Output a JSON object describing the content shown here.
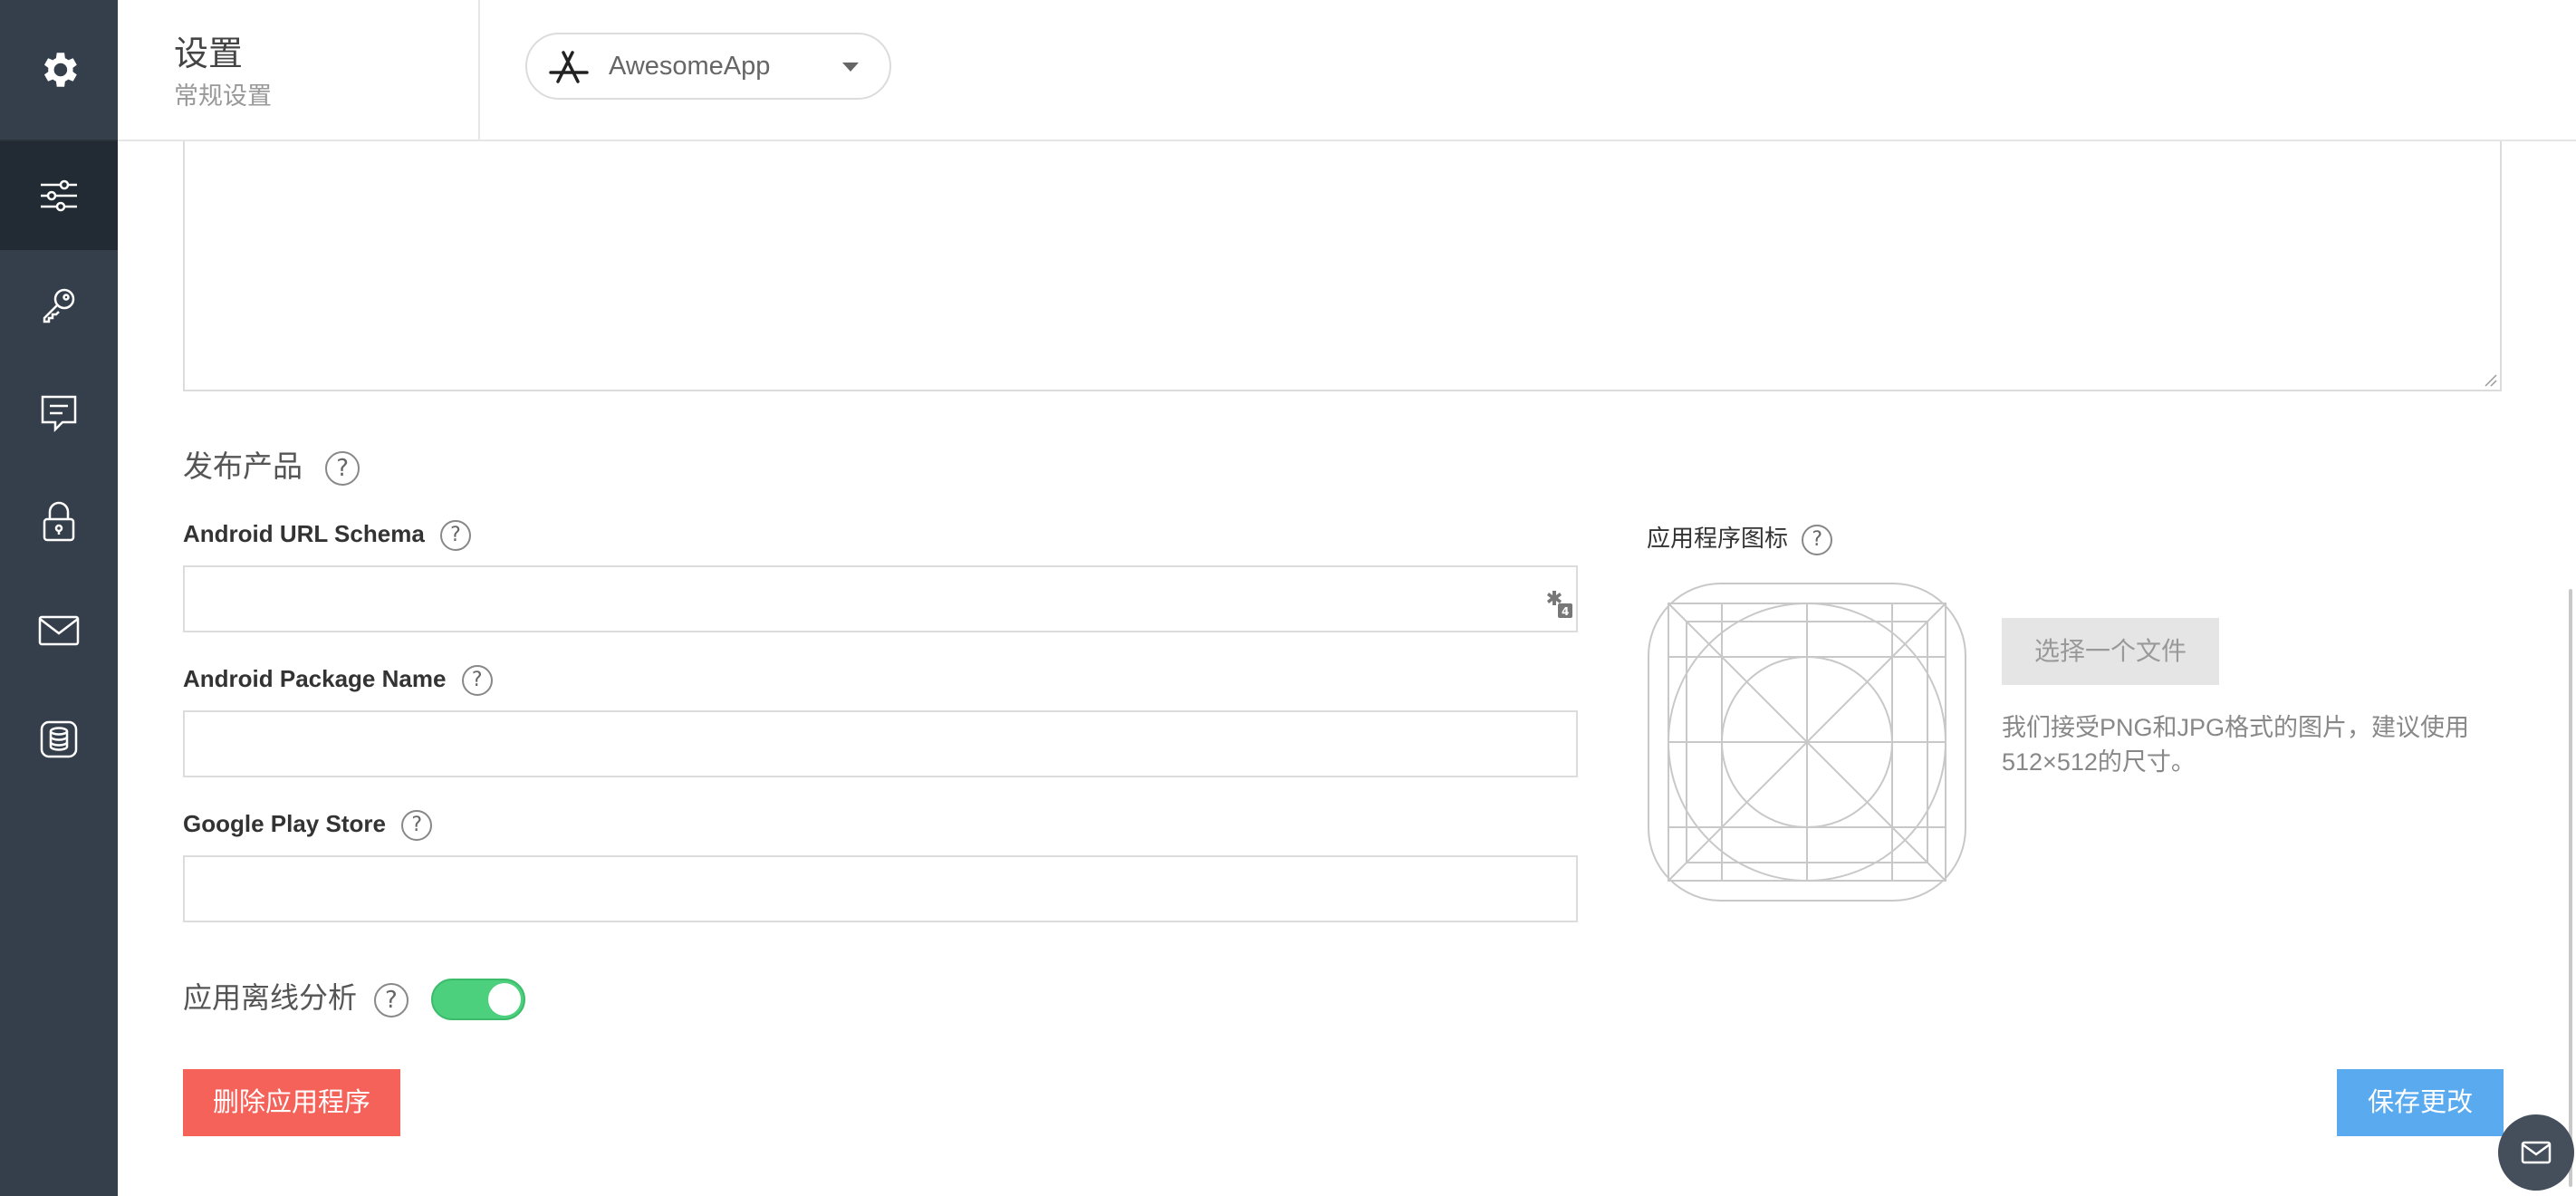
{
  "sidebar": {
    "items": [
      {
        "icon": "gear-icon"
      },
      {
        "icon": "sliders-icon",
        "active": true
      },
      {
        "icon": "key-icon"
      },
      {
        "icon": "message-icon"
      },
      {
        "icon": "lock-icon"
      },
      {
        "icon": "mail-icon"
      },
      {
        "icon": "database-icon"
      }
    ]
  },
  "header": {
    "title": "设置",
    "subtitle": "常规设置",
    "app_selector": {
      "value": "AwesomeApp",
      "icon": "app-store-icon"
    }
  },
  "publish": {
    "section_title": "发布产品",
    "help": "?",
    "fields": [
      {
        "label": "Android URL Schema",
        "value": ""
      },
      {
        "label": "Android Package Name",
        "value": ""
      },
      {
        "label": "Google Play Store",
        "value": ""
      }
    ]
  },
  "app_icon": {
    "label": "应用程序图标",
    "choose_button": "选择一个文件",
    "hint": "我们接受PNG和JPG格式的图片，建议使用512×512的尺寸。"
  },
  "offline": {
    "label": "应用离线分析",
    "enabled": true
  },
  "actions": {
    "delete_label": "删除应用程序",
    "save_label": "保存更改"
  },
  "colors": {
    "sidebar": "#353f4b",
    "sidebar_active": "#222a34",
    "toggle_on": "#4cd07d",
    "danger": "#f4625a",
    "primary": "#5aaaf0"
  }
}
